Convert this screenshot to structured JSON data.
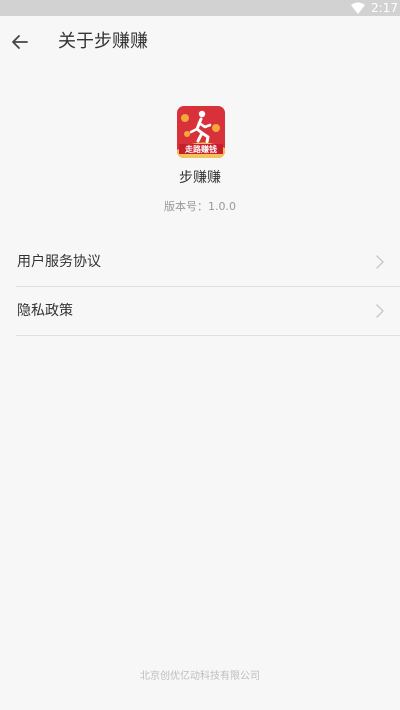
{
  "status_bar": {
    "time": "2:17"
  },
  "header": {
    "title": "关于步赚赚",
    "back_icon": "arrow-left"
  },
  "app": {
    "logo_text": "走路赚钱",
    "name": "步赚赚",
    "version": "版本号：1.0.0"
  },
  "menu": {
    "items": [
      {
        "label": "用户服务协议"
      },
      {
        "label": "隐私政策"
      }
    ]
  },
  "footer": {
    "company": "北京创优亿动科技有限公司"
  },
  "colors": {
    "background": "#f6f7f6",
    "status_bar": "#d2d2d2",
    "logo_red": "#d9313a",
    "divider": "#e0e0e0"
  }
}
